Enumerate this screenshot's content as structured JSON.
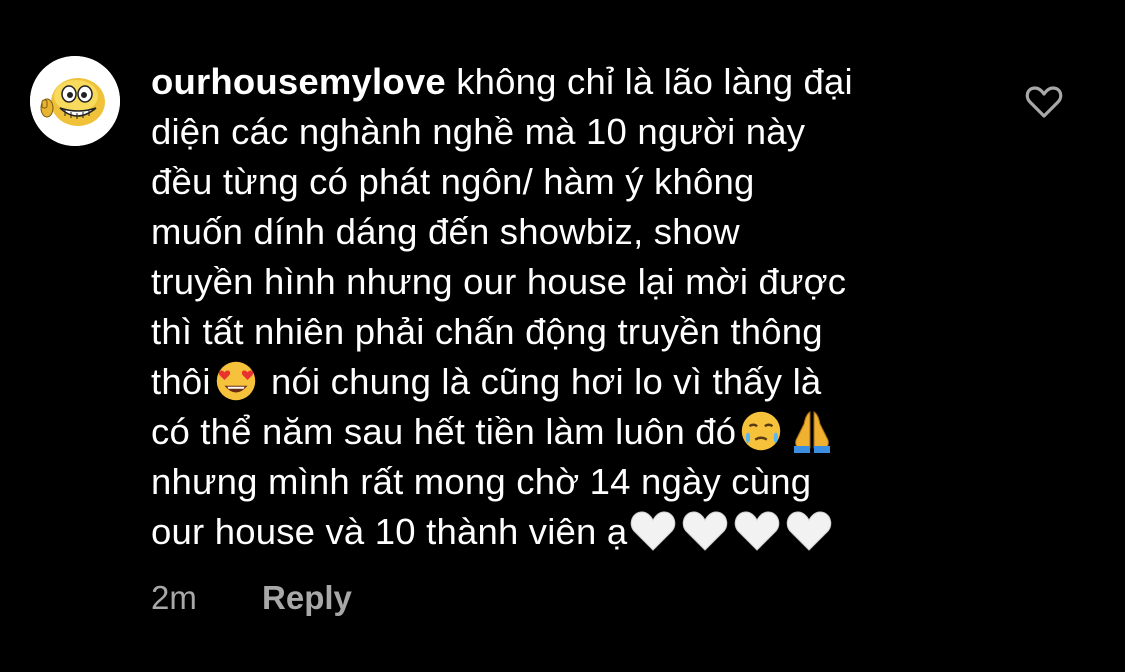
{
  "comment": {
    "username": "ourhousemylove",
    "lines": [
      " không chỉ là lão làng đại",
      "diện các nghành nghề mà 10 người này",
      "đều từng có phát ngôn/ hàm ý không",
      "muốn dính dáng đến showbiz, show",
      "truyền hình nhưng our house lại mời được",
      "thì tất nhiên phải chấn động truyền thông"
    ],
    "line7_a": "thôi",
    "line7_b": " nói chung là cũng hơi lo vì thấy là",
    "line8": "có thể năm sau hết tiền làm luôn đó",
    "line9": "nhưng mình rất mong chờ 14 ngày cùng",
    "line10": "our house và 10 thành viên ạ",
    "emojis": [
      "heart-eyes-emoji",
      "face-holding-back-tears-emoji",
      "folded-hands-emoji",
      "white-heart-emoji"
    ]
  },
  "meta": {
    "time": "2m",
    "reply_label": "Reply"
  },
  "colors": {
    "background": "#000000",
    "text": "#ffffff",
    "secondary": "#a8a8a8"
  }
}
